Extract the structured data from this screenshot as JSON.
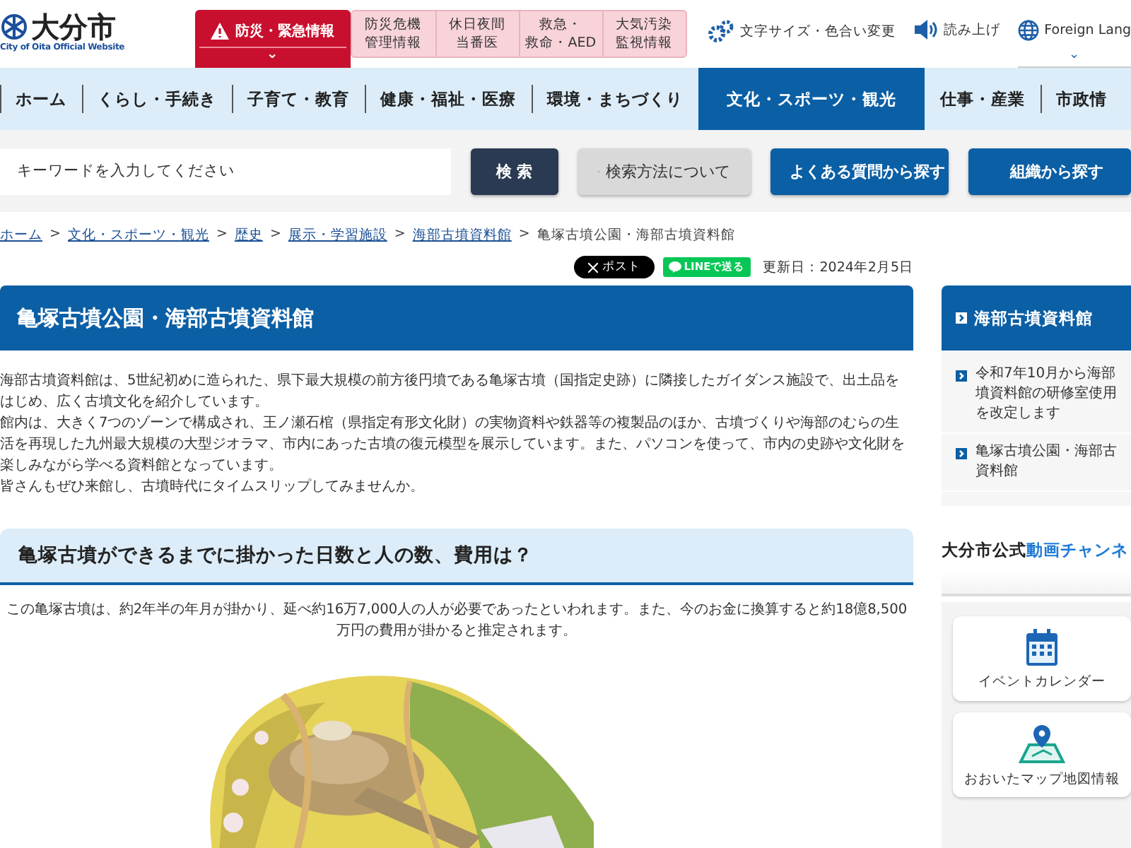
{
  "header": {
    "logo_title": "大分市",
    "logo_subtitle": "City of Oita Official Website",
    "emergency": {
      "label": "防災・緊急情報",
      "caret": "⌄"
    },
    "quick_links": [
      {
        "lines": [
          "防災危機",
          "管理情報"
        ]
      },
      {
        "lines": [
          "休日夜間",
          "当番医"
        ]
      },
      {
        "lines": [
          "救急・",
          "救命・AED"
        ]
      },
      {
        "lines": [
          "大気汚染",
          "監視情報"
        ]
      }
    ],
    "tools": [
      {
        "kind": "gear",
        "label": "文字サイズ・色合い変更"
      },
      {
        "kind": "speaker",
        "label": "読み上げ"
      },
      {
        "kind": "globe",
        "label": "Foreign Lang",
        "caret": "⌄"
      }
    ]
  },
  "nav": [
    {
      "label": "ホーム",
      "selected": false
    },
    {
      "label": "くらし・手続き",
      "selected": false
    },
    {
      "label": "子育て・教育",
      "selected": false
    },
    {
      "label": "健康・福祉・医療",
      "selected": false
    },
    {
      "label": "環境・まちづくり",
      "selected": false
    },
    {
      "label": "文化・スポーツ・観光",
      "selected": true
    },
    {
      "label": "仕事・産業",
      "selected": false
    },
    {
      "label": "市政情",
      "selected": false
    }
  ],
  "search": {
    "placeholder": "キーワードを入力してください",
    "button": "検 索",
    "help": "検索方法について",
    "faq": "よくある質問から探す",
    "org": "組織から探す"
  },
  "breadcrumb": {
    "links": [
      "ホーム",
      "文化・スポーツ・観光",
      "歴史",
      "展示・学習施設",
      "海部古墳資料館"
    ],
    "separator": ">",
    "current": "亀塚古墳公園・海部古墳資料館"
  },
  "share": {
    "post": "ポスト",
    "line": "LINEで送る",
    "updated": "更新日：2024年2月5日"
  },
  "article": {
    "title": "亀塚古墳公園・海部古墳資料館",
    "paragraphs": [
      "海部古墳資料館は、5世紀初めに造られた、県下最大規模の前方後円墳である亀塚古墳（国指定史跡）に隣接したガイダンス施設で、出土品をはじめ、広く古墳文化を紹介しています。",
      "館内は、大きく7つのゾーンで構成され、王ノ瀬石棺（県指定有形文化財）の実物資料や鉄器等の複製品のほか、古墳づくりや海部のむらの生活を再現した九州最大規模の大型ジオラマ、市内にあった古墳の復元模型を展示しています。また、パソコンを使って、市内の史跡や文化財を楽しみながら学べる資料館となっています。",
      "皆さんもぜひ来館し、古墳時代にタイムスリップしてみませんか。"
    ],
    "section_heading": "亀塚古墳ができるまでに掛かった日数と人の数、費用は？",
    "section_text": "この亀塚古墳は、約2年半の年月が掛かり、延べ約16万7,000人の人が必要であったといわれます。また、今のお金に換算すると約18億8,500万円の費用が掛かると推定されます。"
  },
  "sidebar": {
    "heading": "海部古墳資料館",
    "links": [
      {
        "lines": [
          "令和7年10月から海部",
          "墳資料館の研修室使用",
          "を改定します"
        ]
      },
      {
        "lines": [
          "亀塚古墳公園・海部古",
          "資料館"
        ]
      }
    ],
    "banner": {
      "prefix": "大分市公式",
      "highlight": "動画チャンネ"
    },
    "cards": [
      {
        "kind": "calendar",
        "label": "イベントカレンダー"
      },
      {
        "kind": "map",
        "label": "おおいたマップ地図情報"
      }
    ]
  }
}
